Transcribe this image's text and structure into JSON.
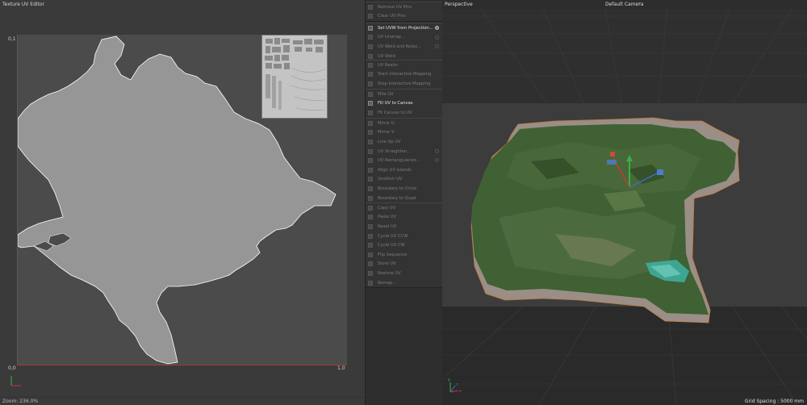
{
  "uv_editor": {
    "title": "Texture UV Editor",
    "tick_top": "0,1",
    "tick_origin": "0,0",
    "tick_right": "1,0",
    "zoom": "Zoom: 236.0%"
  },
  "commands": [
    {
      "items": [
        {
          "label": "Remove UV Pins",
          "active": false,
          "gear": false
        },
        {
          "label": "Clear UV Pins",
          "active": false,
          "gear": false
        }
      ]
    },
    {
      "items": [
        {
          "label": "Set UVW from Projection...",
          "active": true,
          "gear": true
        },
        {
          "label": "UV Unwrap...",
          "active": false,
          "gear": true
        },
        {
          "label": "UV Weld and Relax...",
          "active": false,
          "gear": true
        },
        {
          "label": "UV Weld",
          "active": false,
          "gear": false
        }
      ]
    },
    {
      "items": [
        {
          "label": "UV Realm",
          "active": false,
          "gear": false
        },
        {
          "label": "Start Interactive Mapping",
          "active": false,
          "gear": false
        },
        {
          "label": "Stop Interactive Mapping",
          "active": false,
          "gear": false
        }
      ]
    },
    {
      "items": [
        {
          "label": "Mile UV",
          "active": false,
          "gear": false
        },
        {
          "label": "Fill UV to Canvas",
          "active": true,
          "gear": false
        },
        {
          "label": "Fit Canvas to UV",
          "active": false,
          "gear": false
        }
      ]
    },
    {
      "items": [
        {
          "label": "Mirror U",
          "active": false,
          "gear": false
        },
        {
          "label": "Mirror V",
          "active": false,
          "gear": false
        },
        {
          "label": "Line Up UV",
          "active": false,
          "gear": false
        },
        {
          "label": "UV Straighten...",
          "active": false,
          "gear": true
        },
        {
          "label": "UV Rectangularize...",
          "active": false,
          "gear": true
        },
        {
          "label": "Align UV Islands",
          "active": false,
          "gear": false
        },
        {
          "label": "Unstitch UV",
          "active": false,
          "gear": false
        },
        {
          "label": "Boundary to Circle",
          "active": false,
          "gear": false
        },
        {
          "label": "Boundary to Quad",
          "active": false,
          "gear": false
        }
      ]
    },
    {
      "items": [
        {
          "label": "Copy UV",
          "active": false,
          "gear": false
        },
        {
          "label": "Paste UV",
          "active": false,
          "gear": false
        },
        {
          "label": "Reset UV",
          "active": false,
          "gear": false
        },
        {
          "label": "Cycle UV CCW",
          "active": false,
          "gear": false
        },
        {
          "label": "Cycle UV CW",
          "active": false,
          "gear": false
        },
        {
          "label": "Flip Sequence",
          "active": false,
          "gear": false
        },
        {
          "label": "Store UV",
          "active": false,
          "gear": false
        },
        {
          "label": "Restore UV",
          "active": false,
          "gear": false
        },
        {
          "label": "Remap...",
          "active": false,
          "gear": false
        }
      ]
    }
  ],
  "viewport": {
    "view_name": "Perspective",
    "camera": "Default Camera",
    "grid_spacing": "Grid Spacing : 5000 mm"
  }
}
